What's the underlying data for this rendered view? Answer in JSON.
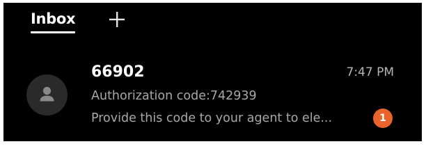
{
  "tabs": {
    "inbox_label": "Inbox",
    "add_icon": "plus-icon"
  },
  "conversation": {
    "sender": "66902",
    "time": "7:47 PM",
    "subject": "Authorization code:742939",
    "preview": "Provide this code to your agent to ele...",
    "unread_count": "1",
    "avatar_icon": "person-icon"
  },
  "colors": {
    "background": "#000000",
    "badge": "#e8642a",
    "avatar_bg": "#2a2a2a"
  }
}
